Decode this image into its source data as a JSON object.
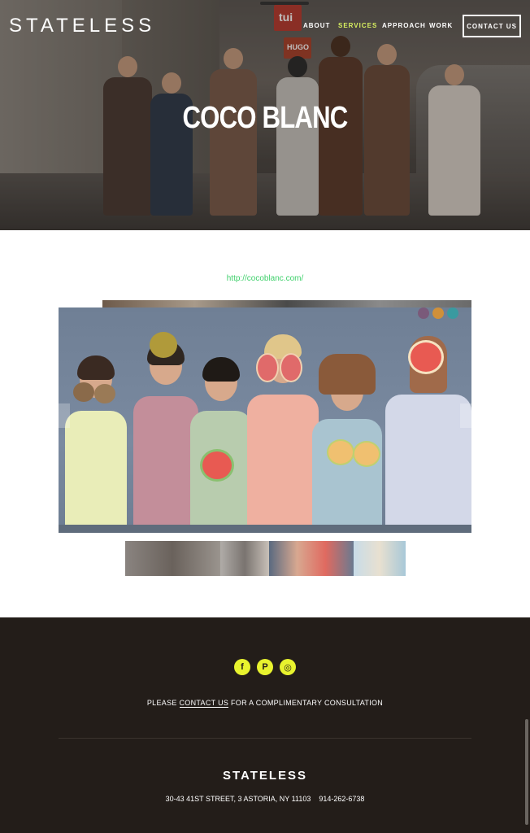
{
  "header": {
    "logo": "STATELESS",
    "nav": [
      {
        "label": "ABOUT",
        "active": false
      },
      {
        "label": "SERVICES",
        "active": true
      },
      {
        "label": "APPROACH",
        "active": false
      },
      {
        "label": "WORK",
        "active": false
      }
    ],
    "contact_button": "CONTACT US"
  },
  "hero": {
    "title": "COCO BLANC",
    "signs": [
      "tui",
      "HUGO"
    ]
  },
  "project": {
    "url": "http://cocoblanc.com/",
    "main_image_alt_icon": "children-with-fruit-photo",
    "thumbnail_count": 4
  },
  "footer": {
    "social": [
      {
        "icon": "facebook-icon",
        "glyph": "f"
      },
      {
        "icon": "pinterest-icon",
        "glyph": "P"
      },
      {
        "icon": "instagram-icon",
        "glyph": "◎"
      }
    ],
    "cta_prefix": "PLEASE ",
    "cta_link": "CONTACT US",
    "cta_suffix": " FOR A COMPLIMENTARY CONSULTATION",
    "logo": "STATELESS",
    "address": "30-43 41ST STREET, 3 ASTORIA, NY 11103",
    "phone": "914-262-6738"
  },
  "colors": {
    "accent": "#d8f060",
    "link_green": "#3dd06a",
    "footer_bg": "#231d19",
    "social_yellow": "#e8f32e"
  }
}
